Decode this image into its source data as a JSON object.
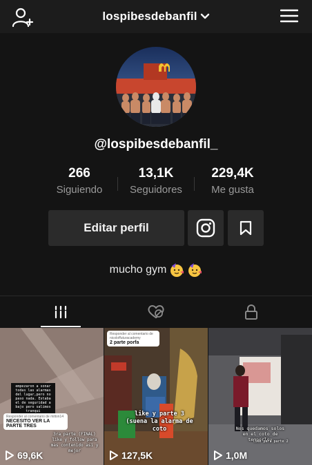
{
  "header": {
    "title": "lospibesdebanfil",
    "icons": {
      "add_user": "add-user-icon",
      "dropdown": "chevron-down-icon",
      "menu": "hamburger-menu-icon"
    }
  },
  "profile": {
    "handle": "@lospibesdebanfil_",
    "avatar": "avatar-image",
    "stats": [
      {
        "value": "266",
        "label": "Siguiendo"
      },
      {
        "value": "13,1K",
        "label": "Seguidores"
      },
      {
        "value": "229,4K",
        "label": "Me gusta"
      }
    ],
    "edit_label": "Editar perfil",
    "bio": "mucho gym",
    "bio_emojis": [
      "party-face-emoji",
      "party-face-emoji"
    ]
  },
  "tabs": [
    {
      "name": "videos",
      "icon": "grid-icon",
      "active": true
    },
    {
      "name": "liked",
      "icon": "hidden-heart-icon",
      "active": false
    },
    {
      "name": "private",
      "icon": "lock-icon",
      "active": false
    }
  ],
  "videos": [
    {
      "views": "69,6K",
      "caption_main": "empezaron a sonar todas las alarmas del lugar,pero no paso nada. Estaba el de seguridad a bajo pero salimos tranqui",
      "sticker_reply": "Responder al comentario de milton14",
      "sticker_text": "NECESITO VER LA PARTE TRES",
      "caption_footer": "3ra parte (FINAL) like y follow para mas contenido asi y mejor"
    },
    {
      "views": "127,5K",
      "sticker_reply": "Responder al comentario de nicoloffuturacademy",
      "sticker_text": "2 parte porfa",
      "caption_main": "like y parte 3 (suena la alarma de coto"
    },
    {
      "views": "1,0M",
      "caption_main": "Nos quedamos solos en el coto de temperley",
      "caption_footer": "like para parte 2"
    }
  ]
}
